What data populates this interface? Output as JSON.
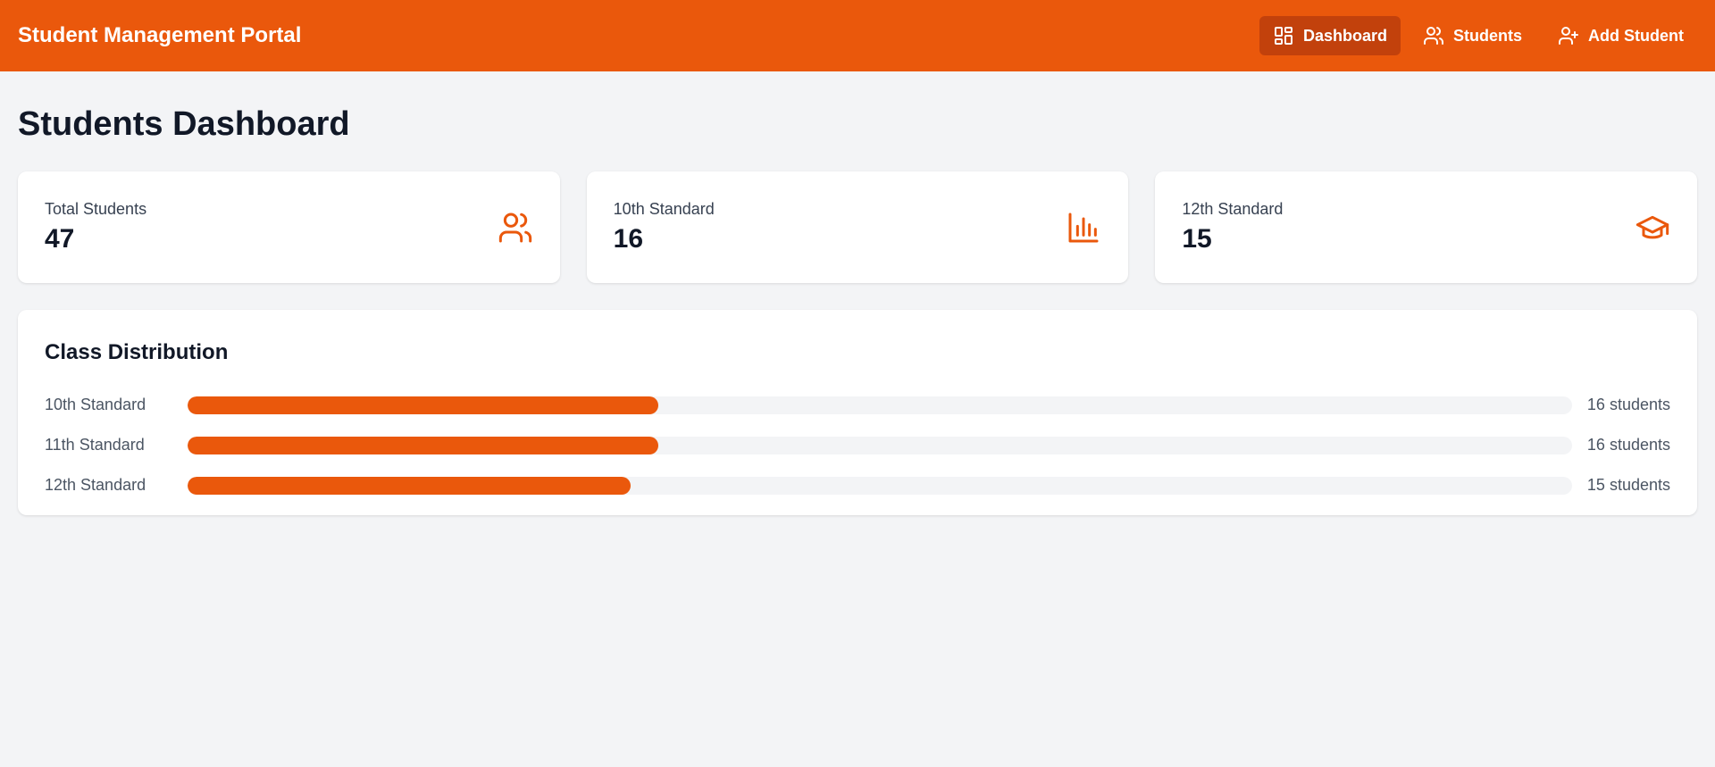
{
  "app": {
    "title": "Student Management Portal"
  },
  "nav": {
    "items": [
      {
        "label": "Dashboard",
        "icon": "dashboard-icon",
        "active": true
      },
      {
        "label": "Students",
        "icon": "users-icon",
        "active": false
      },
      {
        "label": "Add Student",
        "icon": "user-plus-icon",
        "active": false
      }
    ]
  },
  "page": {
    "title": "Students Dashboard"
  },
  "stats": [
    {
      "label": "Total Students",
      "value": "47",
      "icon": "users-icon"
    },
    {
      "label": "10th Standard",
      "value": "16",
      "icon": "bar-chart-icon"
    },
    {
      "label": "12th Standard",
      "value": "15",
      "icon": "graduation-cap-icon"
    }
  ],
  "distribution": {
    "title": "Class Distribution",
    "rows": [
      {
        "label": "10th Standard",
        "count_text": "16 students",
        "fraction": 0.34
      },
      {
        "label": "11th Standard",
        "count_text": "16 students",
        "fraction": 0.34
      },
      {
        "label": "12th Standard",
        "count_text": "15 students",
        "fraction": 0.32
      }
    ]
  },
  "colors": {
    "accent": "#ea580c",
    "accent_dark": "#c2410c",
    "background": "#f3f4f6"
  }
}
